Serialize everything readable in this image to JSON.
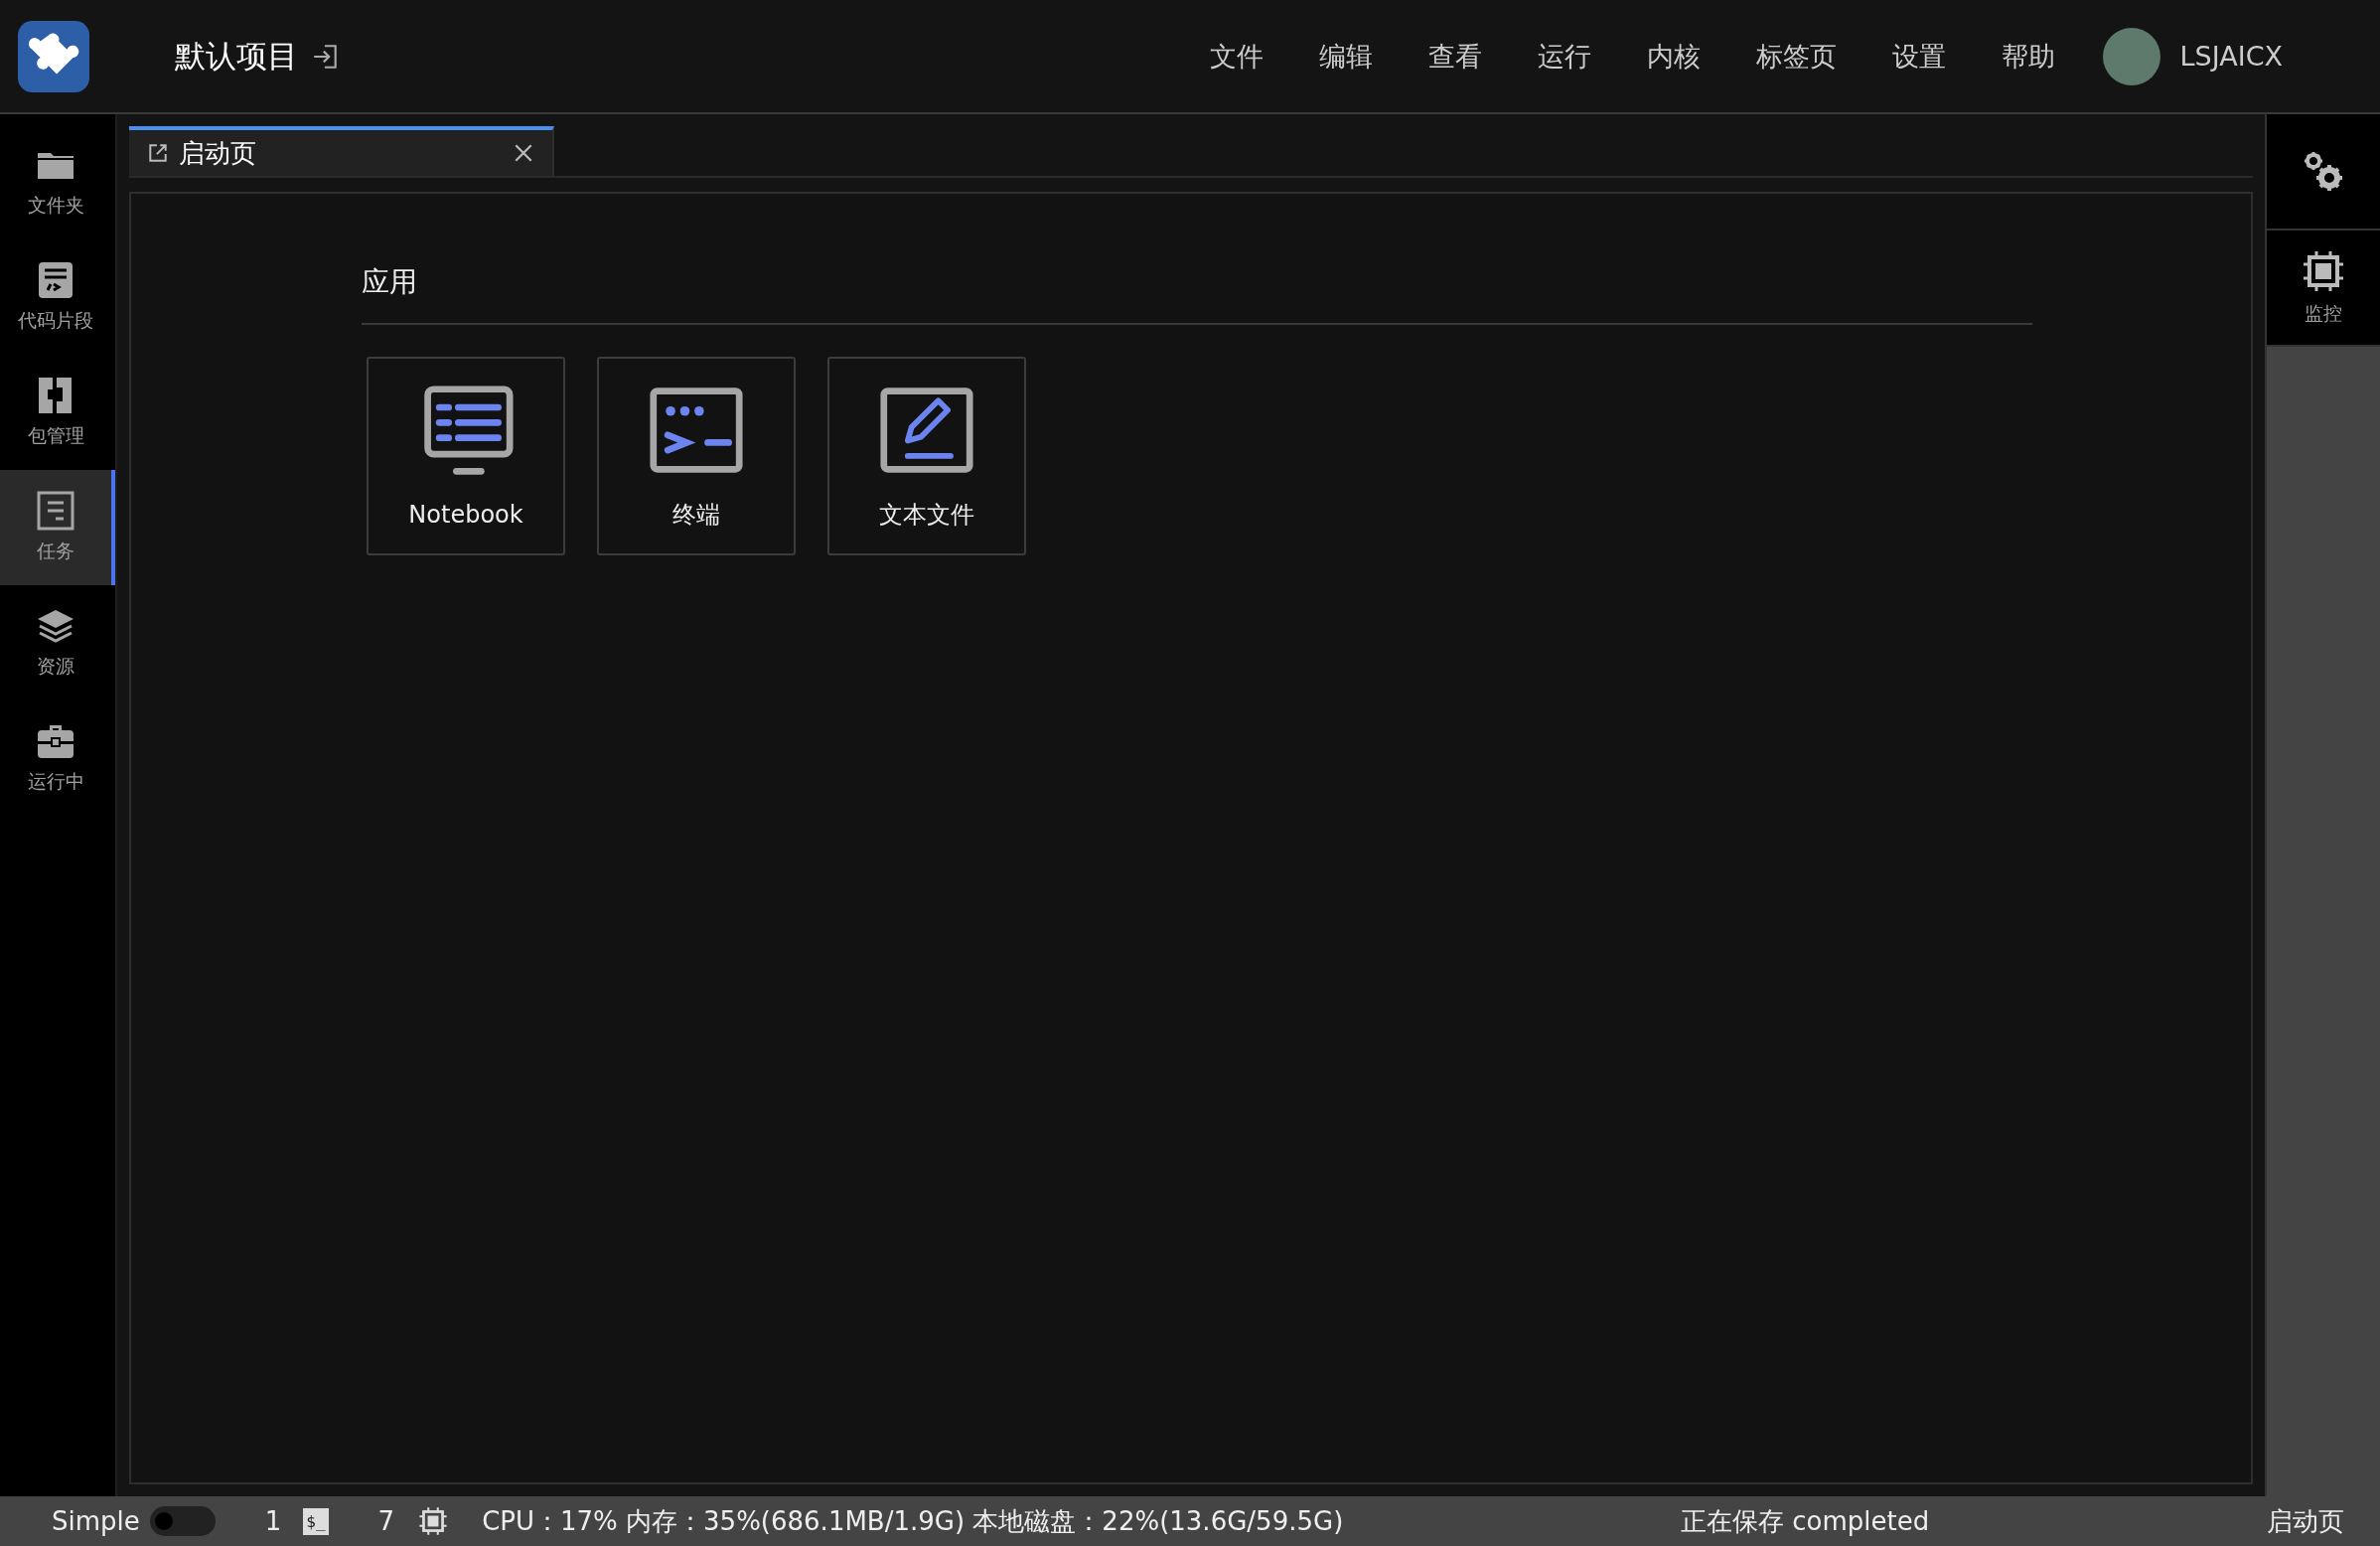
{
  "header": {
    "project_title": "默认项目",
    "menu": [
      "文件",
      "编辑",
      "查看",
      "运行",
      "内核",
      "标签页",
      "设置",
      "帮助"
    ],
    "username": "LSJAICX"
  },
  "sidebar": {
    "items": [
      {
        "label": "文件夹",
        "kind": "folder",
        "selected": false
      },
      {
        "label": "代码片段",
        "kind": "snippet",
        "selected": false
      },
      {
        "label": "包管理",
        "kind": "package",
        "selected": false
      },
      {
        "label": "任务",
        "kind": "tasks",
        "selected": true
      },
      {
        "label": "资源",
        "kind": "layers",
        "selected": false
      },
      {
        "label": "运行中",
        "kind": "briefcase",
        "selected": false
      }
    ]
  },
  "right_sidebar": {
    "items": [
      {
        "kind": "gears"
      },
      {
        "kind": "chip",
        "label": "监控"
      }
    ]
  },
  "tabs": [
    {
      "label": "启动页",
      "selected": true
    }
  ],
  "launcher": {
    "section_title": "应用",
    "apps": [
      {
        "label": "Notebook",
        "kind": "notebook"
      },
      {
        "label": "终端",
        "kind": "terminal"
      },
      {
        "label": "文本文件",
        "kind": "text"
      }
    ]
  },
  "status_bar": {
    "mode_label": "Simple",
    "mode_on": false,
    "terminal_count": "1",
    "terminal_glyph": "$_",
    "kernel_count": "7",
    "resources": "CPU：17% 内存：35%(686.1MB/1.9G) 本地磁盘：22%(13.6G/59.5G)",
    "save_status": "正在保存 completed",
    "current_tab": "启动页"
  }
}
